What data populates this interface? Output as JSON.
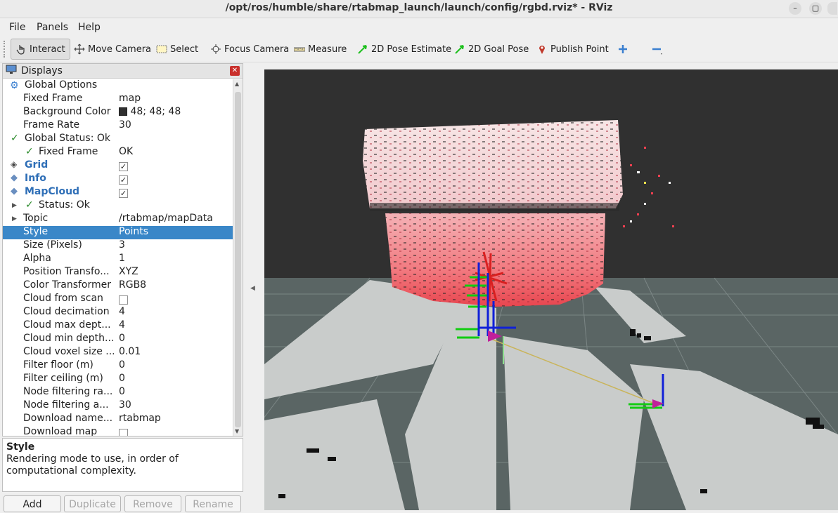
{
  "window": {
    "title": "/opt/ros/humble/share/rtabmap_launch/launch/config/rgbd.rviz* - RViz"
  },
  "menubar": {
    "file": "File",
    "panels": "Panels",
    "help": "Help"
  },
  "toolbar": {
    "interact": "Interact",
    "move_camera": "Move Camera",
    "select": "Select",
    "focus_camera": "Focus Camera",
    "measure": "Measure",
    "pose_estimate": "2D Pose Estimate",
    "goal_pose": "2D Goal Pose",
    "publish_point": "Publish Point"
  },
  "displays_panel": {
    "title": "Displays",
    "rows": [
      {
        "name": "Global Options",
        "value": ""
      },
      {
        "name": "Fixed Frame",
        "value": "map"
      },
      {
        "name": "Background Color",
        "value": "48; 48; 48"
      },
      {
        "name": "Frame Rate",
        "value": "30"
      },
      {
        "name": "Global Status: Ok",
        "value": ""
      },
      {
        "name": "Fixed Frame",
        "value": "OK"
      },
      {
        "name": "Grid",
        "value": ""
      },
      {
        "name": "Info",
        "value": ""
      },
      {
        "name": "MapCloud",
        "value": ""
      },
      {
        "name": "Status: Ok",
        "value": ""
      },
      {
        "name": "Topic",
        "value": "/rtabmap/mapData"
      },
      {
        "name": "Style",
        "value": "Points"
      },
      {
        "name": "Size (Pixels)",
        "value": "3"
      },
      {
        "name": "Alpha",
        "value": "1"
      },
      {
        "name": "Position Transfo...",
        "value": "XYZ"
      },
      {
        "name": "Color Transformer",
        "value": "RGB8"
      },
      {
        "name": "Cloud from scan",
        "value": ""
      },
      {
        "name": "Cloud decimation",
        "value": "4"
      },
      {
        "name": "Cloud max dept...",
        "value": "4"
      },
      {
        "name": "Cloud min depth...",
        "value": "0"
      },
      {
        "name": "Cloud voxel size ...",
        "value": "0.01"
      },
      {
        "name": "Filter floor (m)",
        "value": "0"
      },
      {
        "name": "Filter ceiling (m)",
        "value": "0"
      },
      {
        "name": "Node filtering ra...",
        "value": "0"
      },
      {
        "name": "Node filtering a...",
        "value": "30"
      },
      {
        "name": "Download name...",
        "value": "rtabmap"
      },
      {
        "name": "Download map",
        "value": ""
      }
    ]
  },
  "description": {
    "title": "Style",
    "text": "Rendering mode to use, in order of computational complexity."
  },
  "buttons": {
    "add": "Add",
    "duplicate": "Duplicate",
    "remove": "Remove",
    "rename": "Rename"
  },
  "colors": {
    "background": "#303030",
    "selection": "#3a87c8",
    "display_name": "#2f6fb7"
  }
}
